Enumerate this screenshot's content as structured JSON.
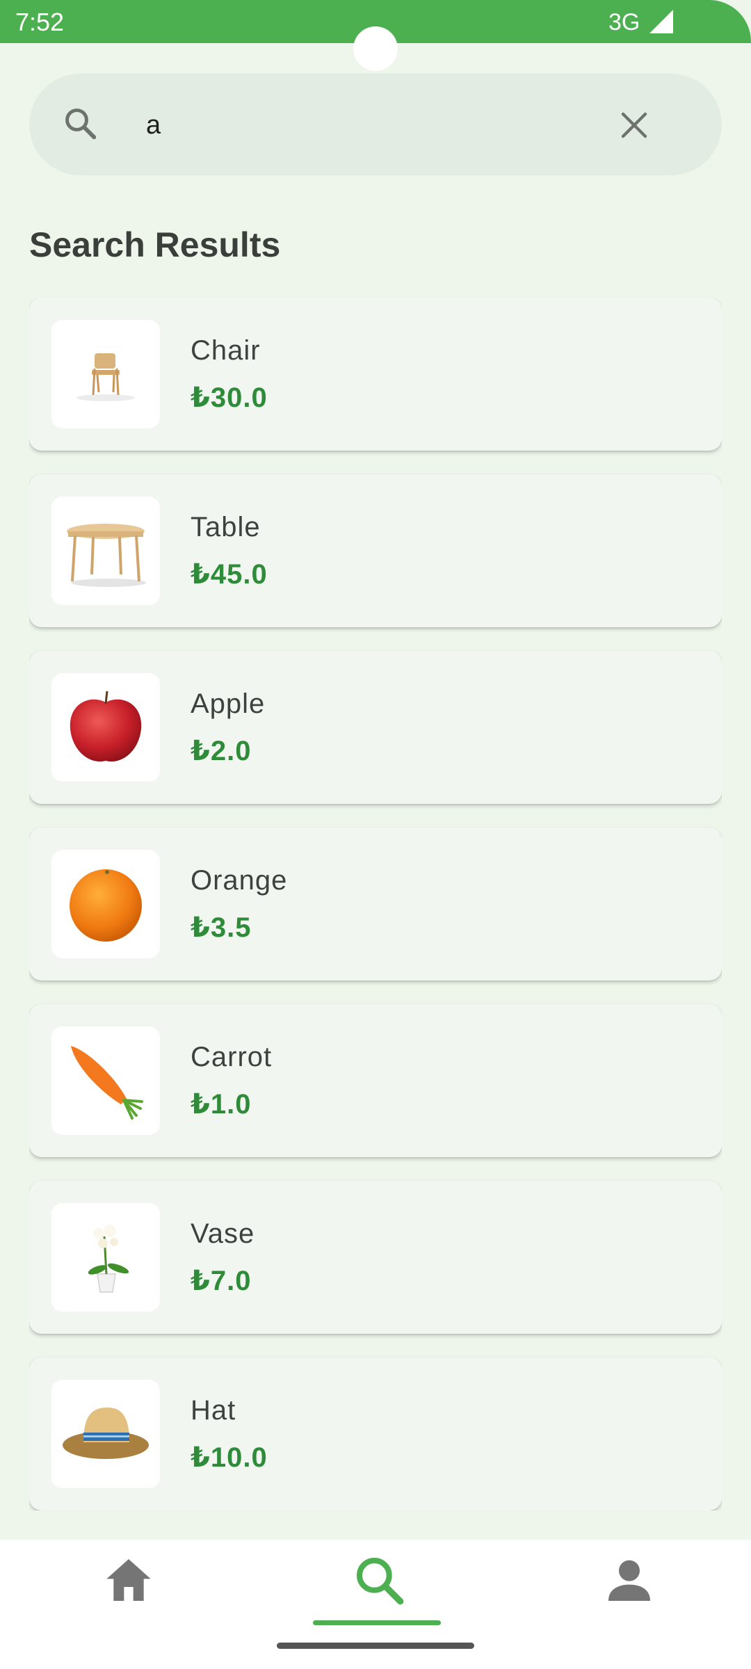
{
  "status_bar": {
    "time": "7:52",
    "network": "3G",
    "color": "#4caf50"
  },
  "search": {
    "value": "a",
    "icon": "search-icon",
    "clear_icon": "close-icon"
  },
  "section_title": "Search Results",
  "results": [
    {
      "name": "Chair",
      "price": "₺30.0",
      "image": "chair-image"
    },
    {
      "name": "Table",
      "price": "₺45.0",
      "image": "table-image"
    },
    {
      "name": "Apple",
      "price": "₺2.0",
      "image": "apple-image"
    },
    {
      "name": "Orange",
      "price": "₺3.5",
      "image": "orange-image"
    },
    {
      "name": "Carrot",
      "price": "₺1.0",
      "image": "carrot-image"
    },
    {
      "name": "Vase",
      "price": "₺7.0",
      "image": "vase-image"
    },
    {
      "name": "Hat",
      "price": "₺10.0",
      "image": "hat-image"
    }
  ],
  "bottom_nav": {
    "items": [
      {
        "icon": "home-icon",
        "active": false
      },
      {
        "icon": "search-icon",
        "active": true
      },
      {
        "icon": "person-icon",
        "active": false
      }
    ],
    "active_color": "#4caf50",
    "inactive_color": "#757575"
  },
  "colors": {
    "accent": "#4caf50",
    "price": "#2e8b3a",
    "background": "#eef6ec",
    "card": "#f1f7f0"
  }
}
